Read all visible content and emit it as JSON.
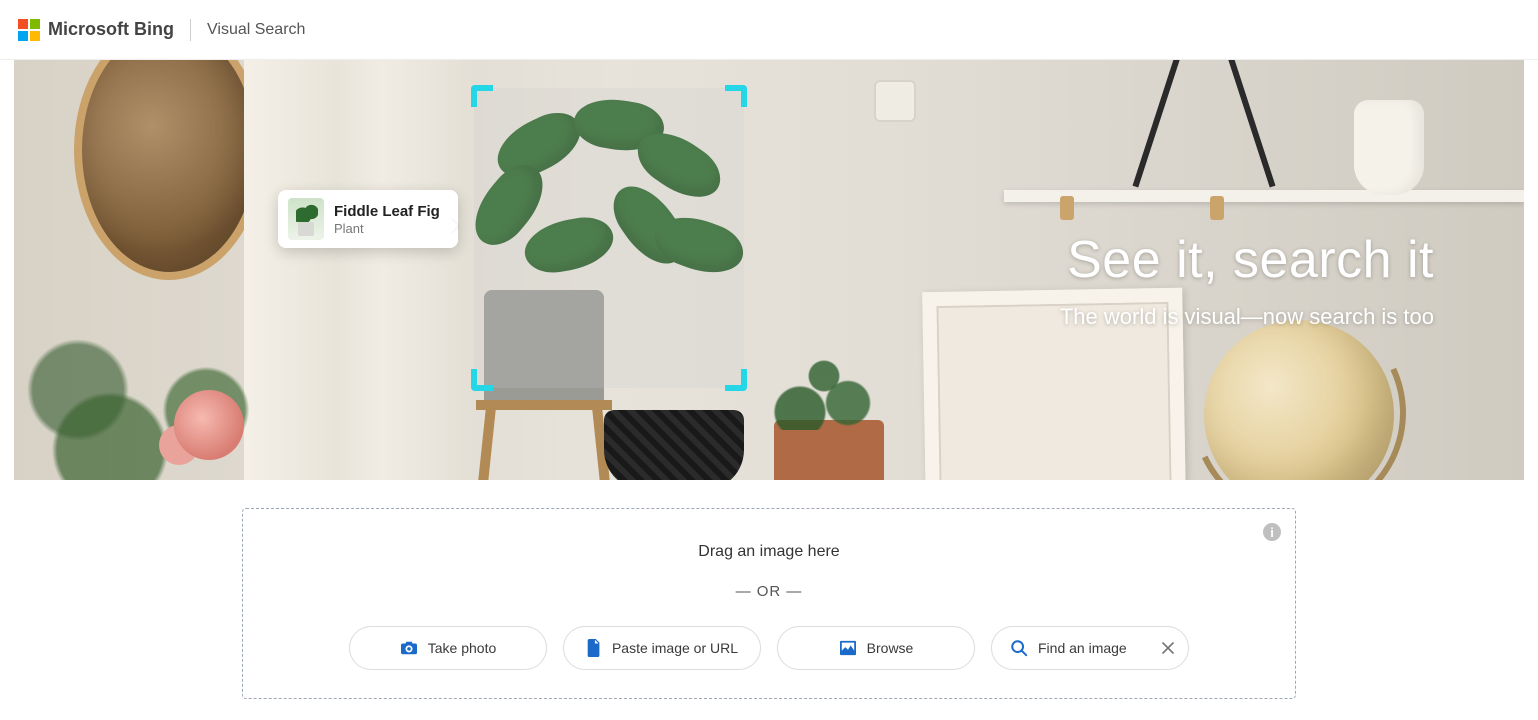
{
  "header": {
    "brand": "Microsoft Bing",
    "section": "Visual Search"
  },
  "hero": {
    "title": "See it, search it",
    "subtitle": "The world is visual—now search is too",
    "detection": {
      "title": "Fiddle Leaf Fig",
      "category": "Plant"
    }
  },
  "upload": {
    "drag_text": "Drag an image here",
    "or_text": "— OR —",
    "info_glyph": "i",
    "buttons": {
      "take_photo": "Take photo",
      "paste": "Paste image or URL",
      "browse": "Browse",
      "find": "Find an image"
    }
  },
  "colors": {
    "accent_crop": "#25d6e6",
    "icon_blue": "#1b6ac9"
  }
}
